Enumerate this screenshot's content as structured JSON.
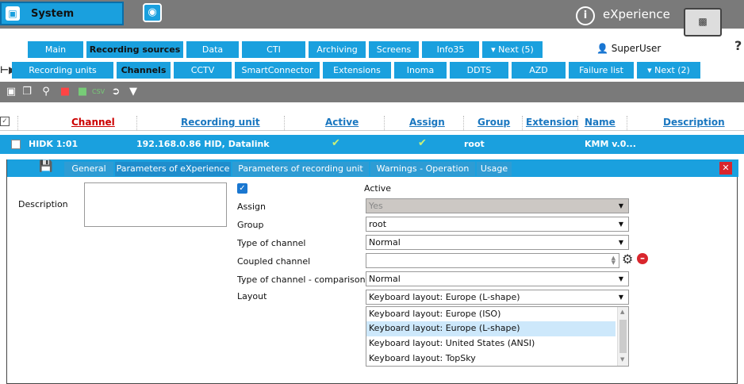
{
  "colors": {
    "accent": "#1aa0de",
    "topbar": "#7a7a7a",
    "close": "#d9262d",
    "link": "#1a77c0",
    "sort": "#c00000"
  },
  "topbar": {
    "system_label": "System",
    "brand": "eXperience",
    "info_icon": "info-icon",
    "monitor_icon": "monitor-icon"
  },
  "user": {
    "name": "SuperUser"
  },
  "main_tabs": [
    "Main",
    "Recording sources",
    "Data",
    "CTI",
    "Archiving",
    "Screens",
    "Info35",
    "▾ Next (5)"
  ],
  "sub_tabs": [
    "Recording units",
    "Channels",
    "CCTV",
    "SmartConnector",
    "Extensions",
    "Inoma",
    "DDTS",
    "AZD",
    "Failure list",
    "▾ Next (2)"
  ],
  "toolbar_icons": [
    "add-icon",
    "copy-icon",
    "search-icon",
    "database-icon",
    "export-icon",
    "csv-icon",
    "import-icon",
    "filter-remove-icon"
  ],
  "table": {
    "headers": [
      "Channel",
      "Recording unit",
      "Active",
      "Assign",
      "Group",
      "Extension",
      "Name",
      "Description"
    ],
    "row": {
      "channel": "HIDK 1:01",
      "unit": "192.168.0.86 HID, Datalink",
      "active": "✔",
      "assign": "✔",
      "group": "root",
      "extension": "",
      "name": "KMM v.0...",
      "description": ""
    }
  },
  "detail": {
    "tabs": [
      "General",
      "Parameters of eXperience",
      "Parameters of recording unit",
      "Warnings - Operation",
      "Usage"
    ],
    "description_label": "Description",
    "active_label": "Active",
    "fields": [
      {
        "label": "Assign",
        "value": "Yes"
      },
      {
        "label": "Group",
        "value": "root"
      },
      {
        "label": "Type of channel",
        "value": "Normal"
      },
      {
        "label": "Coupled channel",
        "value": ""
      },
      {
        "label": "Type of channel - comparison",
        "value": "Normal"
      },
      {
        "label": "Layout",
        "value": "Keyboard layout: Europe (L-shape)"
      }
    ],
    "layout_options": [
      "Keyboard layout: Europe (ISO)",
      "Keyboard layout: Europe (L-shape)",
      "Keyboard layout: United States (ANSI)",
      "Keyboard layout: TopSky"
    ]
  }
}
